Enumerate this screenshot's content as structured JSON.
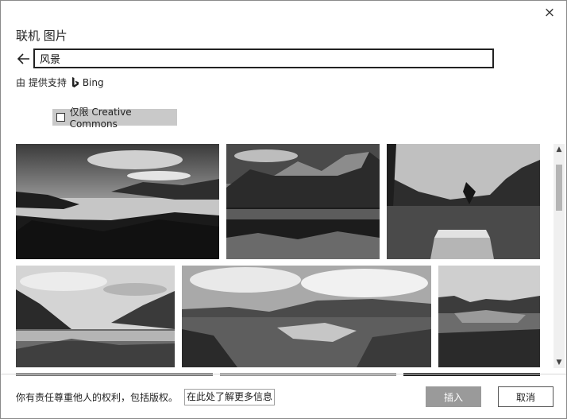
{
  "dialog": {
    "title": "联机 图片",
    "close_glyph": "×",
    "search": {
      "value": "风景",
      "placeholder": ""
    },
    "powered_prefix": "由 提供支持",
    "powered_brand": "Bing",
    "cc_filter_label": "仅限 Creative Commons",
    "cc_filter_checked": false
  },
  "results": {
    "images": [
      {
        "name": "lake-sunset-panorama"
      },
      {
        "name": "mountain-lake-reflection"
      },
      {
        "name": "tropical-lake-raft"
      },
      {
        "name": "valley-lake-clouds"
      },
      {
        "name": "river-valley-hills"
      },
      {
        "name": "hill-meadow"
      }
    ]
  },
  "footer": {
    "notice": "你有责任尊重他人的权利，包括版权。",
    "learn_more": "在此处了解更多信息",
    "insert_label": "插入",
    "cancel_label": "取消"
  },
  "scrollbar": {
    "up_glyph": "▲",
    "down_glyph": "▼"
  },
  "colors": {
    "insert_disabled": "#9a9a9a",
    "filter_bg": "#c9c9c9"
  }
}
